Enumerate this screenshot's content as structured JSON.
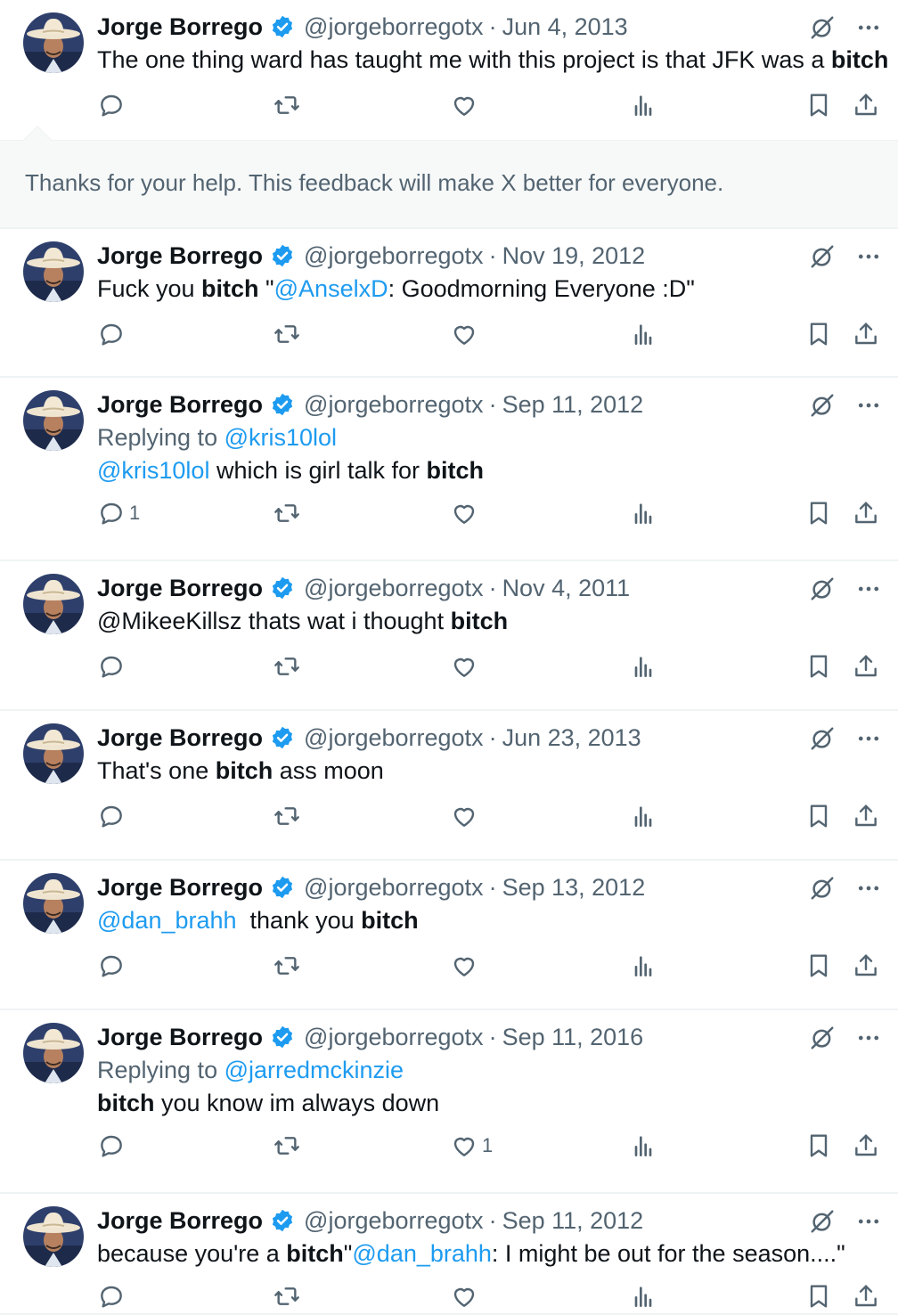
{
  "user": {
    "name": "Jorge Borrego",
    "handle": "@jorgeborregotx",
    "separator": "·",
    "avatar_icon": "cowboy-hat-avatar",
    "verified_icon": "verified-badge-icon",
    "accent_color": "#1d9bf0"
  },
  "feedback": {
    "message": "Thanks for your help. This feedback will make X better for everyone."
  },
  "tweets": [
    {
      "date": "Jun 4, 2013",
      "text": [
        {
          "t": "The one thing ward has taught me with this project is that JFK was a "
        },
        {
          "t": "bitch",
          "bold": true
        }
      ],
      "replies": "",
      "likes": ""
    },
    {
      "date": "Nov 19, 2012",
      "text": [
        {
          "t": "Fuck you "
        },
        {
          "t": "bitch",
          "bold": true
        },
        {
          "t": " \""
        },
        {
          "t": "@AnselxD",
          "link": true
        },
        {
          "t": ": Goodmorning Everyone :D\""
        }
      ],
      "replies": "",
      "likes": ""
    },
    {
      "date": "Sep 11, 2012",
      "replying_label": "Replying to ",
      "replying_to": "@kris10lol",
      "text": [
        {
          "t": "@kris10lol",
          "link": true
        },
        {
          "t": " which is girl talk for "
        },
        {
          "t": "bitch",
          "bold": true
        }
      ],
      "replies": "1",
      "likes": ""
    },
    {
      "date": "Nov 4, 2011",
      "text": [
        {
          "t": "@MikeeKillsz thats wat i thought "
        },
        {
          "t": "bitch",
          "bold": true
        }
      ],
      "replies": "",
      "likes": ""
    },
    {
      "date": "Jun 23, 2013",
      "text": [
        {
          "t": "That's one "
        },
        {
          "t": "bitch",
          "bold": true
        },
        {
          "t": " ass moon"
        }
      ],
      "replies": "",
      "likes": ""
    },
    {
      "date": "Sep 13, 2012",
      "text": [
        {
          "t": "@dan_brahh",
          "link": true
        },
        {
          "t": "  thank you "
        },
        {
          "t": "bitch",
          "bold": true
        }
      ],
      "replies": "",
      "likes": ""
    },
    {
      "date": "Sep 11, 2016",
      "replying_label": "Replying to ",
      "replying_to": "@jarredmckinzie",
      "text": [
        {
          "t": "bitch",
          "bold": true
        },
        {
          "t": " you know im always down"
        }
      ],
      "replies": "",
      "likes": "1"
    },
    {
      "date": "Sep 11, 2012",
      "text": [
        {
          "t": "because you're a "
        },
        {
          "t": "bitch",
          "bold": true
        },
        {
          "t": "\""
        },
        {
          "t": "@dan_brahh",
          "link": true
        },
        {
          "t": ": I might be out for the season....\""
        }
      ],
      "replies": "",
      "likes": ""
    }
  ],
  "icons": {
    "reply": "reply-icon",
    "retweet": "retweet-icon",
    "like": "heart-icon",
    "views": "views-icon",
    "bookmark": "bookmark-icon",
    "share": "share-icon",
    "grok": "grok-icon",
    "more": "more-icon"
  }
}
